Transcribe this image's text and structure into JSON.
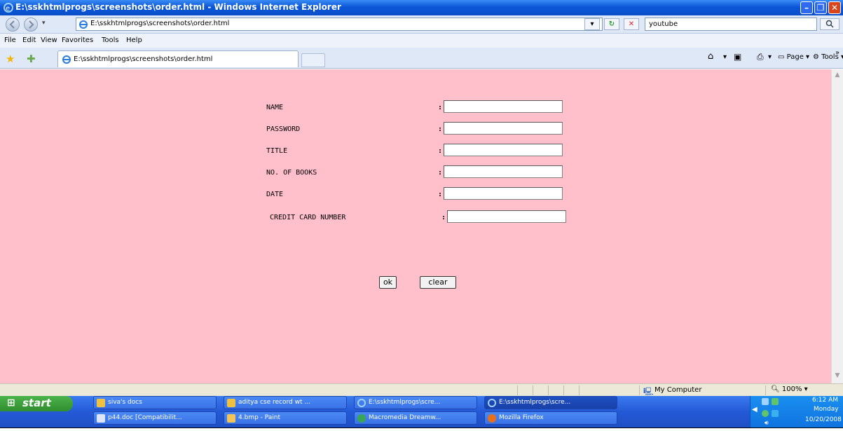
{
  "window": {
    "title": "E:\\sskhtmlprogs\\screenshots\\order.html - Windows Internet Explorer",
    "min_label": "–",
    "max_label": "❐",
    "close_label": "✕"
  },
  "address_bar": {
    "url": "E:\\sskhtmlprogs\\screenshots\\order.html",
    "search_value": "youtube"
  },
  "menu": [
    "File",
    "Edit",
    "View",
    "Favorites",
    "Tools",
    "Help"
  ],
  "tab": {
    "title": "E:\\sskhtmlprogs\\screenshots\\order.html"
  },
  "command_bar": {
    "page": "Page",
    "tools": "Tools",
    "more": "»"
  },
  "form": {
    "fields": [
      {
        "label": "NAME",
        "value": ""
      },
      {
        "label": "PASSWORD",
        "value": ""
      },
      {
        "label": "TITLE",
        "value": ""
      },
      {
        "label": "NO. OF BOOKS",
        "value": ""
      },
      {
        "label": "DATE",
        "value": ""
      },
      {
        "label": "CREDIT CARD NUMBER",
        "value": ""
      }
    ],
    "separator": ":",
    "ok_label": "ok",
    "clear_label": "clear"
  },
  "status_bar": {
    "zone": "My Computer",
    "zoom": "100%"
  },
  "taskbar": {
    "start_label": "start",
    "tasks_row1": [
      "siva's docs",
      "aditya cse record wt ...",
      "E:\\sskhtmlprogs\\scre...",
      "E:\\sskhtmlprogs\\scre..."
    ],
    "tasks_row2": [
      "p44.doc [Compatibilit...",
      "4.bmp - Paint",
      "Macromedia Dreamw...",
      "Mozilla Firefox"
    ],
    "clock": {
      "time": "6:12 AM",
      "day": "Monday",
      "date": "10/20/2008"
    }
  },
  "colors": {
    "page_background": "#ffc0cb",
    "titlebar": "#0b57d8",
    "taskbar": "#2459d6",
    "start_button": "#2f8d2e"
  }
}
